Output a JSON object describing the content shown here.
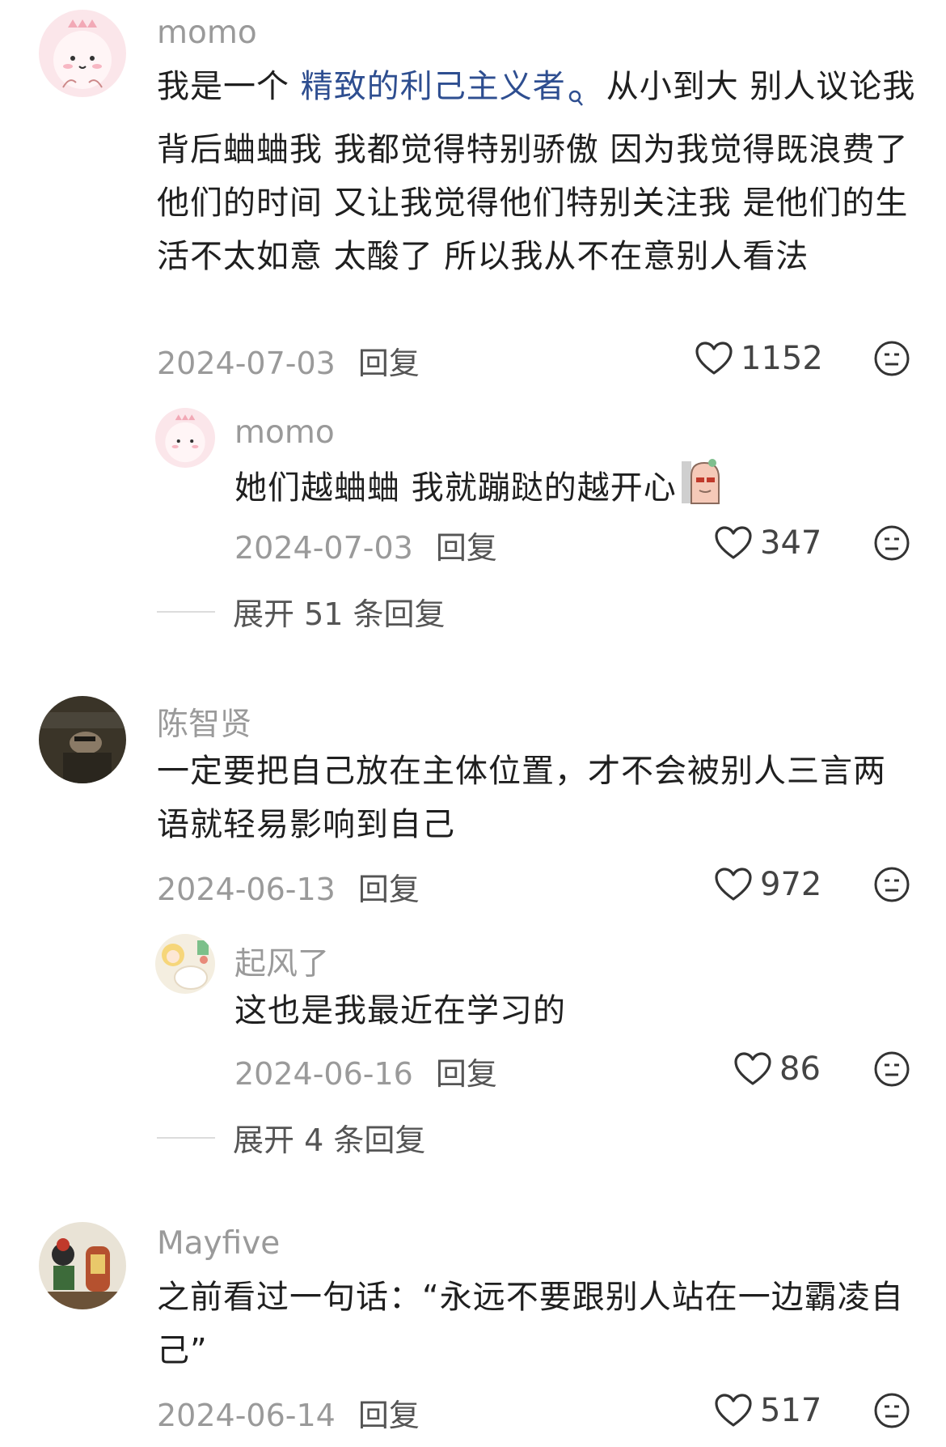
{
  "comments": [
    {
      "username": "momo",
      "text_before": "我是一个 ",
      "link": "精致的利己主义者",
      "text_after": "从小到大 别人议论我 背后蛐蛐我 我都觉得特别骄傲 因为我觉得既浪费了他们的时间 又让我觉得他们特别关注我 是他们的生活不太如意 太酸了 所以我从不在意别人看法",
      "date": "2024-07-03",
      "reply_label": "回复",
      "likes": "1152",
      "avatar_icon": "pink-cartoon-avatar-icon"
    },
    {
      "username": "momo",
      "text": "她们越蛐蛐 我就蹦跶的越开心",
      "date": "2024-07-03",
      "reply_label": "回复",
      "likes": "347",
      "sticker_icon": "peeking-sticker-icon"
    },
    {
      "username": "陈智贤",
      "text": "一定要把自己放在主体位置，才不会被别人三言两语就轻易影响到自己",
      "date": "2024-06-13",
      "reply_label": "回复",
      "likes": "972",
      "avatar_icon": "dark-photo-avatar-icon"
    },
    {
      "username": "起风了",
      "text": "这也是我最近在学习的",
      "date": "2024-06-16",
      "reply_label": "回复",
      "likes": "86",
      "avatar_icon": "anime-girl-avatar-icon"
    },
    {
      "username": "Mayfive",
      "text": "之前看过一句话：“永远不要跟别人站在一边霸凌自己”",
      "date": "2024-06-14",
      "reply_label": "回复",
      "likes": "517",
      "avatar_icon": "toy-collection-avatar-icon"
    }
  ],
  "expand": [
    {
      "label": "展开 51 条回复"
    },
    {
      "label": "展开 4 条回复"
    }
  ],
  "colors": {
    "link": "#2e4e90",
    "meta": "#9a9a9a",
    "text": "#1f1f1f"
  }
}
